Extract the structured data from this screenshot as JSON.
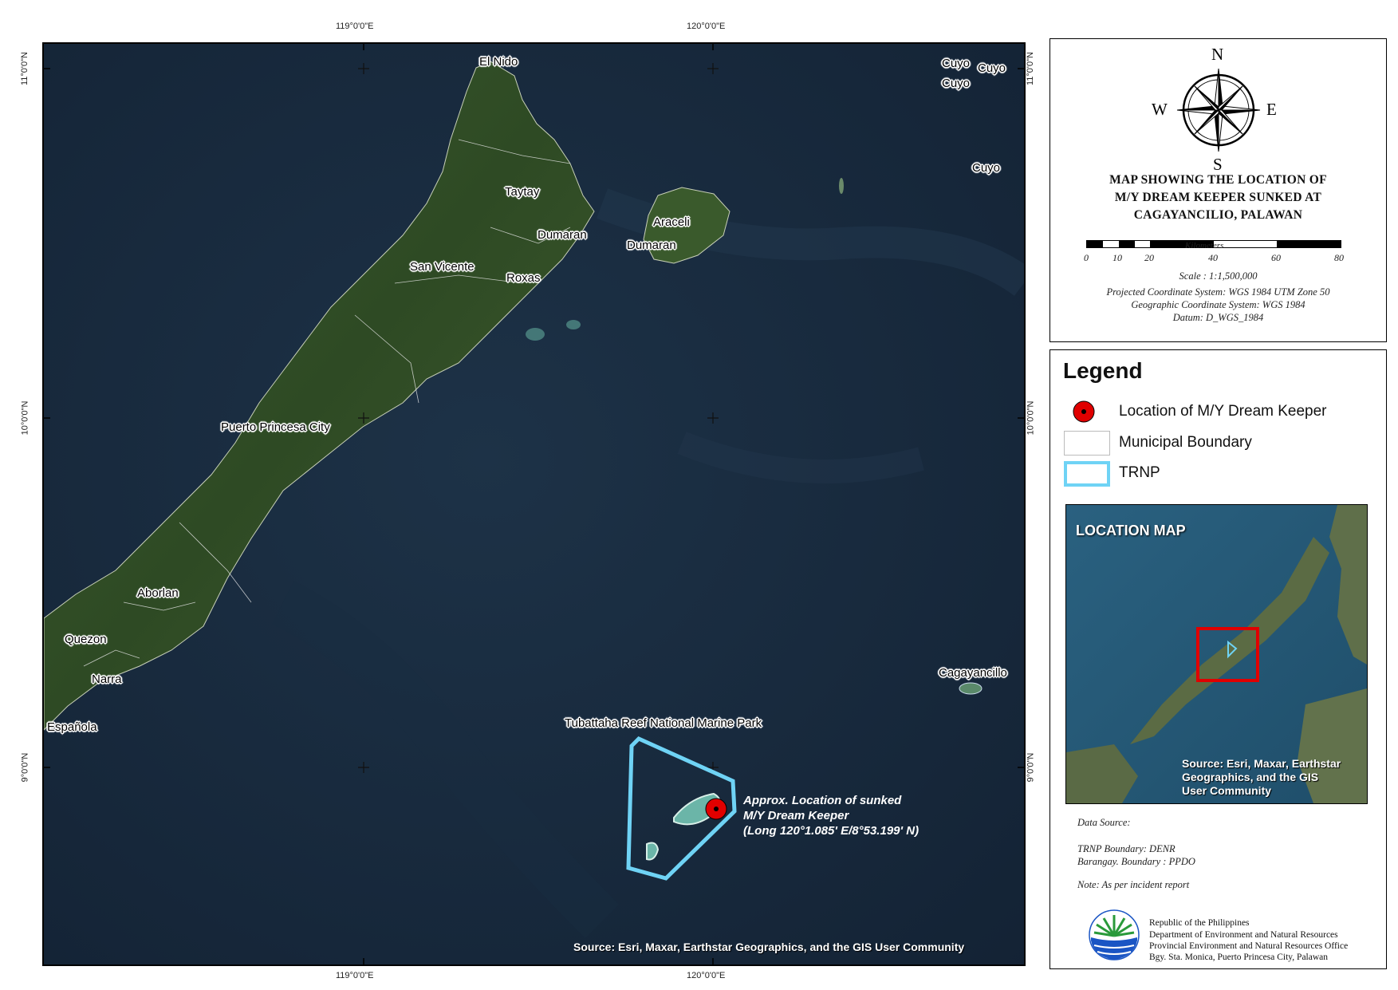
{
  "coordinates": {
    "lon_top": [
      "119°0'0\"E",
      "120°0'0\"E"
    ],
    "lon_bottom": [
      "119°0'0\"E",
      "120°0'0\"E"
    ],
    "lat_left": [
      "11°0'0\"N",
      "10°0'0\"N",
      "9°0'0\"N"
    ],
    "lat_right": [
      "11°0'0\"N",
      "10°0'0\"N",
      "9°0'0\"N"
    ]
  },
  "places": {
    "el_nido": "El Nido",
    "cuyo_1": "Cuyo",
    "cuyo_2": "Cuyo",
    "cuyo_3": "Cuyo",
    "cuyo_4": "Cuyo",
    "taytay": "Taytay",
    "araceli": "Araceli",
    "dumaran_1": "Dumaran",
    "dumaran_2": "Dumaran",
    "san_vicente": "San Vicente",
    "roxas": "Roxas",
    "puerto_princesa": "Puerto Princesa City",
    "aborlan": "Aborlan",
    "quezon": "Quezon",
    "narra": "Narra",
    "espanola": "Española",
    "cagayancillo": "Cagayancillo",
    "tubbataha": "Tubattaha Reef National Marine Park"
  },
  "annotation": {
    "line1": "Approx. Location of sunked",
    "line2": "M/Y Dream Keeper",
    "line3": "(Long 120°1.085' E/8°53.199' N)"
  },
  "map_source": "Source: Esri, Maxar, Earthstar Geographics, and the GIS User Community",
  "compass": {
    "n": "N",
    "s": "S",
    "e": "E",
    "w": "W"
  },
  "title": {
    "line1": "MAP SHOWING THE LOCATION OF",
    "line2": "M/Y DREAM KEEPER SUNKED AT",
    "line3": "CAGAYANCILIO, PALAWAN"
  },
  "scale_bar": {
    "unit": "Kilometers",
    "ticks": [
      "0",
      "10",
      "20",
      "40",
      "60",
      "80"
    ]
  },
  "meta": {
    "scale": "Scale : 1:1,500,000",
    "projected": "Projected Coordinate System: WGS 1984 UTM Zone 50",
    "geographic": "Geographic Coordinate System: WGS 1984",
    "datum": "Datum: D_WGS_1984"
  },
  "legend": {
    "title": "Legend",
    "items": [
      {
        "label": "Location of M/Y Dream Keeper",
        "color": "#e00000"
      },
      {
        "label": "Municipal Boundary",
        "color": "#ffffff"
      },
      {
        "label": "TRNP",
        "color": "#6fd3f5"
      }
    ]
  },
  "inset": {
    "title": "LOCATION MAP",
    "source_line1": "Source: Esri, Maxar, Earthstar",
    "source_line2": "Geographics, and the GIS",
    "source_line3": "User Community",
    "frame_color": "#e00000"
  },
  "notes": {
    "data_source": "Data Source:",
    "trnp": "TRNP Boundary: DENR",
    "barangay": "Barangay. Boundary : PPDO",
    "note": "Note: As per incident report"
  },
  "agency": {
    "line1": "Republic of the Philippines",
    "line2": "Department of Environment and Natural Resources",
    "line3": "Provincial Environment and Natural Resources Office",
    "line4": "Bgy. Sta. Monica, Puerto Princesa City, Palawan"
  },
  "colors": {
    "ocean": "#17283a",
    "land": "#2f4a26",
    "trnp_outline": "#6fd3f5",
    "marker": "#e00000"
  }
}
